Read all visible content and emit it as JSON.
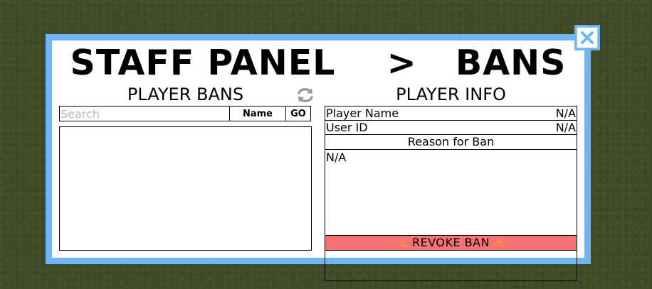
{
  "panel": {
    "title": "STAFF PANEL    >   BANS"
  },
  "bans": {
    "heading": "PLAYER BANS",
    "search_placeholder": "Search",
    "search_value": "",
    "filter_button": "Name",
    "go_button": "GO",
    "items": []
  },
  "info": {
    "heading": "PLAYER INFO",
    "player_name_label": "Player Name",
    "player_name_value": "N/A",
    "user_id_label": "User ID",
    "user_id_value": "N/A",
    "reason_label": "Reason for Ban",
    "reason_value": "N/A"
  },
  "revoke": {
    "label": "REVOKE BAN",
    "icon": "warning-icon",
    "color": "#f77272"
  },
  "colors": {
    "border": "#71b6f4",
    "background": "#3f4a26"
  }
}
